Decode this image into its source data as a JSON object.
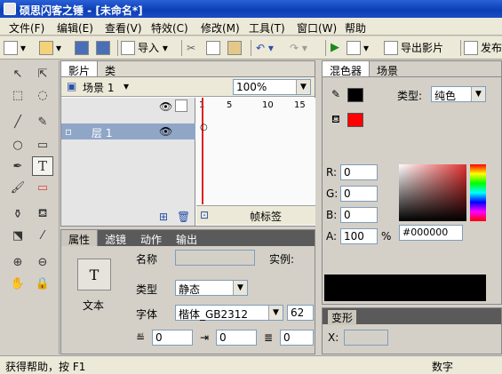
{
  "window": {
    "title": "硕思闪客之锤 - [未命名*]"
  },
  "menu": [
    "文件(F)",
    "编辑(E)",
    "查看(V)",
    "特效(C)",
    "修改(M)",
    "工具(T)",
    "窗口(W)",
    "帮助"
  ],
  "toolbar": {
    "import_label": "导入",
    "export_label": "导出影片",
    "publish_label": "发布"
  },
  "timeline": {
    "tabs": [
      "影片",
      "类"
    ],
    "scene": "场景 1",
    "zoom": "100%",
    "ruler": [
      "1",
      "5",
      "10",
      "15"
    ],
    "layer": "层 1",
    "frame_label": "帧标签"
  },
  "properties": {
    "tabs": [
      "属性",
      "滤镜",
      "动作",
      "输出"
    ],
    "icon_label": "文本",
    "name_label": "名称",
    "instance_label": "实例:",
    "type_label": "类型",
    "type_value": "静态",
    "font_label": "字体",
    "font_value": "楷体_GB2312",
    "font_size": "62",
    "spacing_a": "0",
    "spacing_b": "0",
    "spacing_c": "0"
  },
  "mixer": {
    "tabs": [
      "混色器",
      "场景"
    ],
    "type_label": "类型:",
    "type_value": "纯色",
    "R": "0",
    "G": "0",
    "B": "0",
    "A": "100",
    "percent": "%",
    "hex": "#000000"
  },
  "transform": {
    "title": "变形",
    "x_label": "X:"
  },
  "statusbar": {
    "help": "获得帮助，按 F1",
    "mode": "数字"
  },
  "colors": {
    "stroke": "#000000",
    "fill": "#ff0000",
    "swatch": "#000000"
  }
}
